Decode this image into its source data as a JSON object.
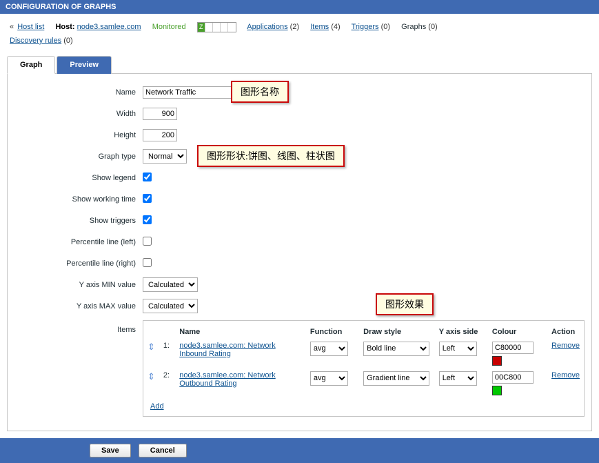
{
  "page_title": "CONFIGURATION OF GRAPHS",
  "breadcrumb": {
    "chev": "«",
    "host_list": "Host list",
    "host_label": "Host:",
    "host_name": "node3.samlee.com",
    "monitored": "Monitored",
    "z_letter": "Z",
    "applications": "Applications",
    "applications_cnt": "(2)",
    "items": "Items",
    "items_cnt": "(4)",
    "triggers": "Triggers",
    "triggers_cnt": "(0)",
    "graphs": "Graphs",
    "graphs_cnt": "(0)",
    "discovery": "Discovery rules",
    "discovery_cnt": "(0)"
  },
  "tabs": {
    "graph": "Graph",
    "preview": "Preview"
  },
  "labels": {
    "name": "Name",
    "width": "Width",
    "height": "Height",
    "graph_type": "Graph type",
    "show_legend": "Show legend",
    "show_working": "Show working time",
    "show_triggers": "Show triggers",
    "pctl_left": "Percentile line (left)",
    "pctl_right": "Percentile line (right)",
    "ymin": "Y axis MIN value",
    "ymax": "Y axis MAX value",
    "items": "Items"
  },
  "values": {
    "name": "Network Traffic",
    "width": "900",
    "height": "200",
    "graph_type": "Normal",
    "ymin": "Calculated",
    "ymax": "Calculated"
  },
  "annotations": {
    "name": "图形名称",
    "type": "图形形状:饼图、线图、柱状图",
    "effect": "图形效果"
  },
  "items_table": {
    "headers": {
      "name": "Name",
      "function": "Function",
      "draw_style": "Draw style",
      "yaxis_side": "Y axis side",
      "colour": "Colour",
      "action": "Action"
    },
    "rows": [
      {
        "idx": "1:",
        "link": "node3.samlee.com: Network Inbound Rating",
        "function": "avg",
        "draw": "Bold line",
        "side": "Left",
        "colour": "C80000",
        "remove": "Remove"
      },
      {
        "idx": "2:",
        "link": "node3.samlee.com: Network Outbound Rating",
        "function": "avg",
        "draw": "Gradient line",
        "side": "Left",
        "colour": "00C800",
        "remove": "Remove"
      }
    ],
    "add": "Add"
  },
  "footer": {
    "save": "Save",
    "cancel": "Cancel"
  }
}
